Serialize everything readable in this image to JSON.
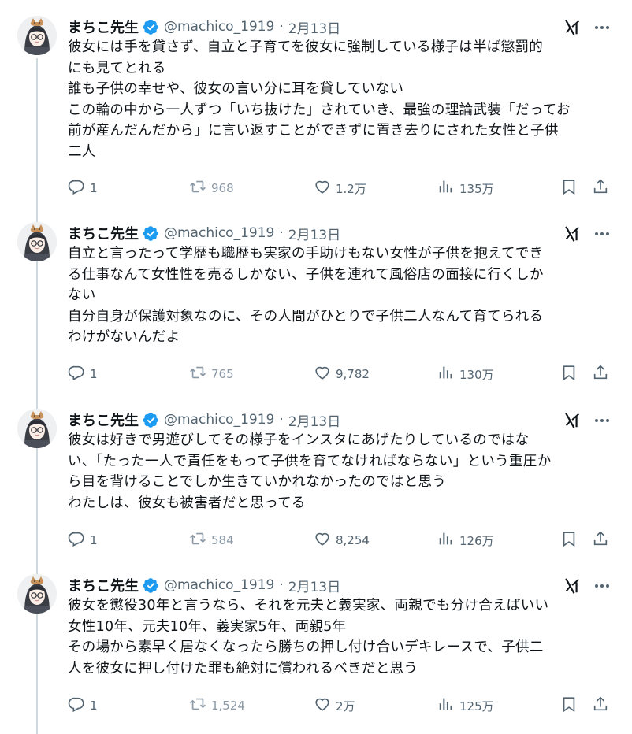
{
  "author": {
    "name": "まちこ先生",
    "handle": "@machico_1919",
    "date": "2月13日",
    "separator": "·"
  },
  "icons": {
    "reply": "reply-icon",
    "retweet": "retweet-icon",
    "like": "heart-icon",
    "views": "views-icon",
    "bookmark": "bookmark-icon",
    "share": "share-icon",
    "grok": "grok-icon",
    "more": "more-icon",
    "verified": "verified-badge-icon"
  },
  "colors": {
    "text": "#0f1419",
    "muted": "#536471",
    "verified": "#1d9bf0",
    "thread_line": "#cfd9de"
  },
  "tweets": [
    {
      "lines": [
        "彼女には手を貸さず、自立と子育てを彼女に強制している様子は半ば懲罰的",
        "にも見てとれる",
        "誰も子供の幸せや、彼女の言い分に耳を貸していない",
        "この輪の中から一人ずつ「いち抜けた」されていき、最強の理論武装「だってお",
        "前が産んだんだから」に言い返すことができずに置き去りにされた女性と子供",
        "二人"
      ],
      "replies": "1",
      "retweets": "968",
      "likes": "1.2万",
      "views": "135万"
    },
    {
      "lines": [
        "自立と言ったって学歴も職歴も実家の手助けもない女性が子供を抱えてでき",
        "る仕事なんて女性性を売るしかない、子供を連れて風俗店の面接に行くしか",
        "ない",
        "自分自身が保護対象なのに、その人間がひとりで子供二人なんて育てられる",
        "わけがないんだよ"
      ],
      "replies": "1",
      "retweets": "765",
      "likes": "9,782",
      "views": "130万"
    },
    {
      "lines": [
        "彼女は好きで男遊びしてその様子をインスタにあげたりしているのではな",
        "い、「たった一人で責任をもって子供を育てなければならない」という重圧か",
        "ら目を背けることでしか生きていかれなかったのではと思う",
        "わたしは、彼女も被害者だと思ってる"
      ],
      "replies": "1",
      "retweets": "584",
      "likes": "8,254",
      "views": "126万"
    },
    {
      "lines": [
        "彼女を懲役30年と言うなら、それを元夫と義実家、両親でも分け合えばいい",
        "女性10年、元夫10年、義実家5年、両親5年",
        "その場から素早く居なくなったら勝ちの押し付け合いデキレースで、子供二",
        "人を彼女に押し付けた罪も絶対に償われるべきだと思う"
      ],
      "replies": "1",
      "retweets": "1,524",
      "likes": "2万",
      "views": "125万"
    }
  ]
}
